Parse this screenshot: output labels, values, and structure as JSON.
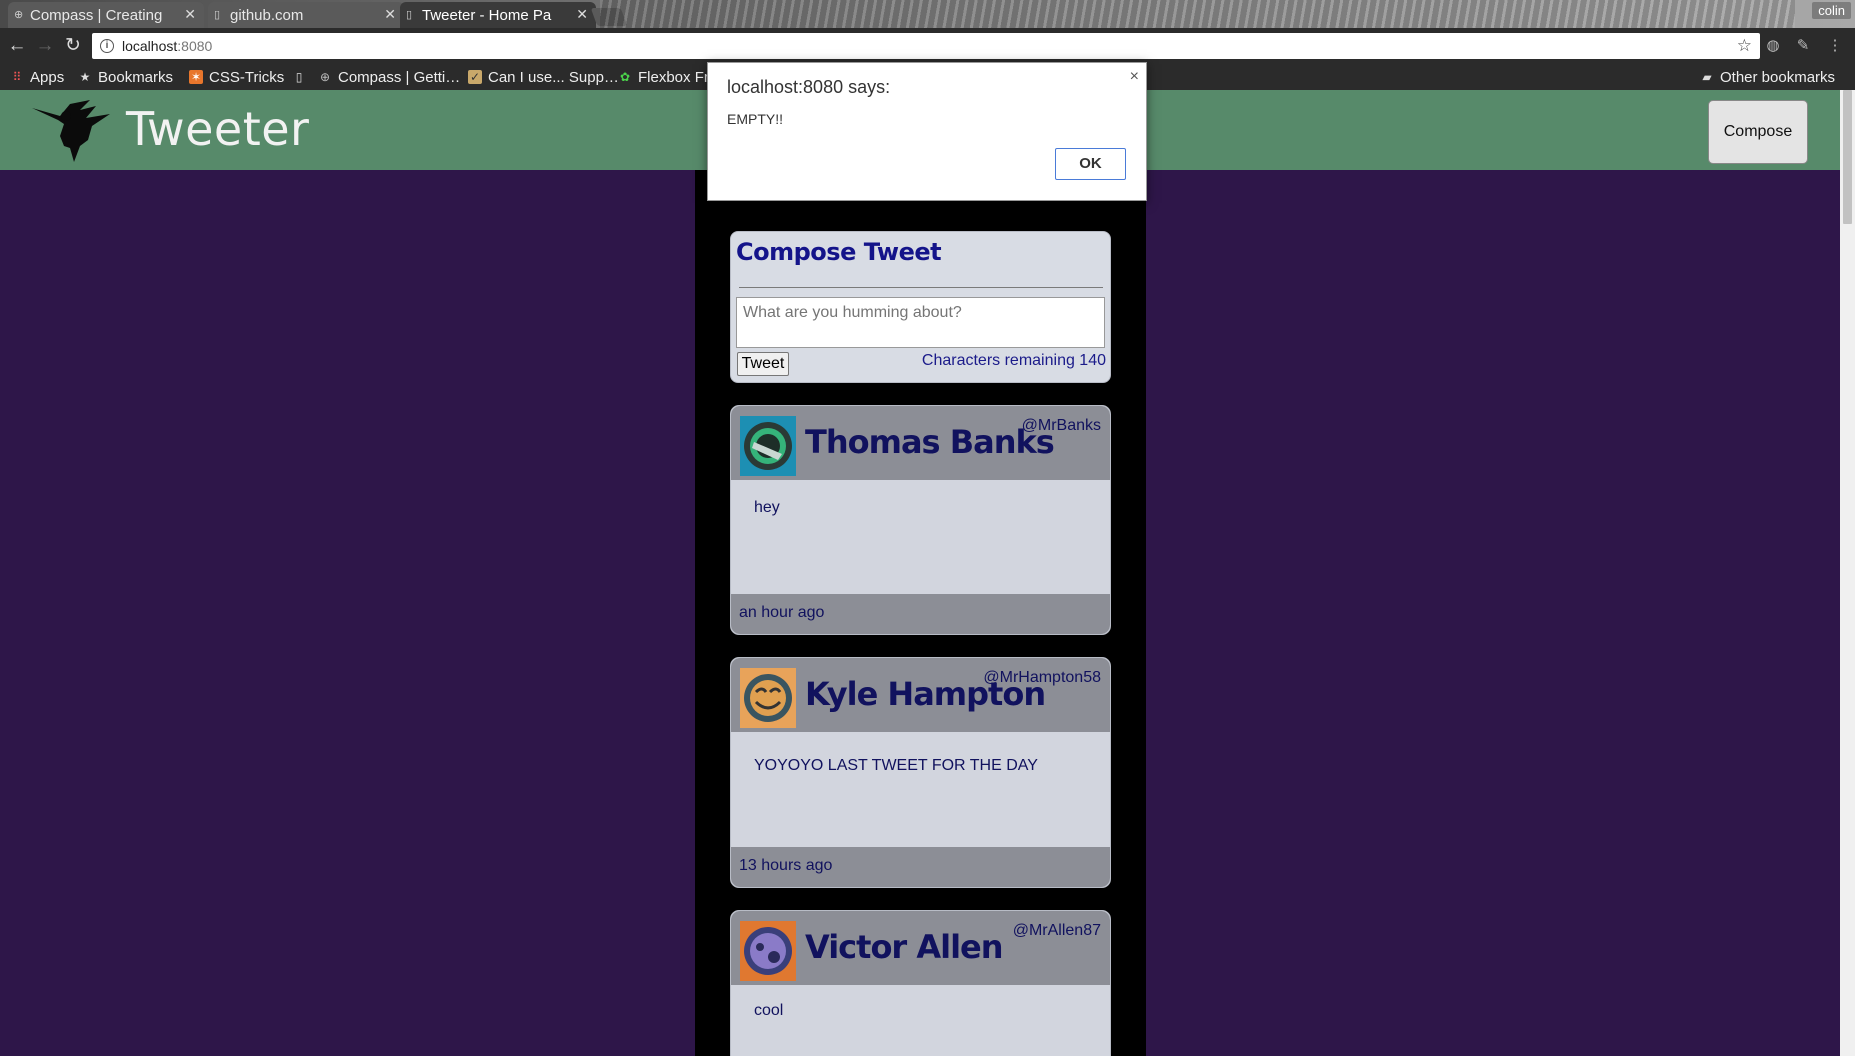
{
  "browser": {
    "tabs": [
      {
        "title": "Compass | Creating",
        "favicon": "compass-favicon"
      },
      {
        "title": "github.com",
        "favicon": "page-favicon"
      },
      {
        "title": "Tweeter - Home Pa",
        "favicon": "page-favicon"
      }
    ],
    "user_name": "colin",
    "address": {
      "host": "localhost",
      "port": ":8080"
    },
    "bookmarks": [
      {
        "label": "Apps",
        "icon": "apps-grid-icon"
      },
      {
        "label": "Bookmarks",
        "icon": "star-icon"
      },
      {
        "label": "CSS-Tricks",
        "icon": "css-tricks-icon"
      },
      {
        "label": "",
        "icon": "page-icon"
      },
      {
        "label": "Compass | Getti…",
        "icon": "compass-icon"
      },
      {
        "label": "Can I use... Supp…",
        "icon": "caniuse-icon"
      },
      {
        "label": "Flexbox Fr",
        "icon": "frog-icon"
      }
    ],
    "other_bookmarks": "Other bookmarks"
  },
  "header": {
    "title": "Tweeter",
    "compose_label": "Compose",
    "logo": "hummingbird-icon",
    "background": "#578a6a"
  },
  "compose": {
    "title": "Compose Tweet",
    "placeholder": "What are you humming about?",
    "tweet_label": "Tweet",
    "counter_label": "Characters remaining 140"
  },
  "tweets": [
    {
      "name": "Thomas Banks",
      "handle": "@MrBanks",
      "text": "hey",
      "time": "an hour ago",
      "avatar": "robot-avatar-teal"
    },
    {
      "name": "Kyle Hampton",
      "handle": "@MrHampton58",
      "text": "YOYOYO LAST TWEET FOR THE DAY",
      "time": "13 hours ago",
      "avatar": "robot-avatar-orange"
    },
    {
      "name": "Victor Allen",
      "handle": "@MrAllen87",
      "text": "cool",
      "time": "",
      "avatar": "robot-avatar-purple"
    }
  ],
  "alert": {
    "title": "localhost:8080 says:",
    "message": "EMPTY!!",
    "ok_label": "OK"
  },
  "colors": {
    "page_background": "#2e1649",
    "column_background": "#000000",
    "text_navy": "#11125e"
  }
}
